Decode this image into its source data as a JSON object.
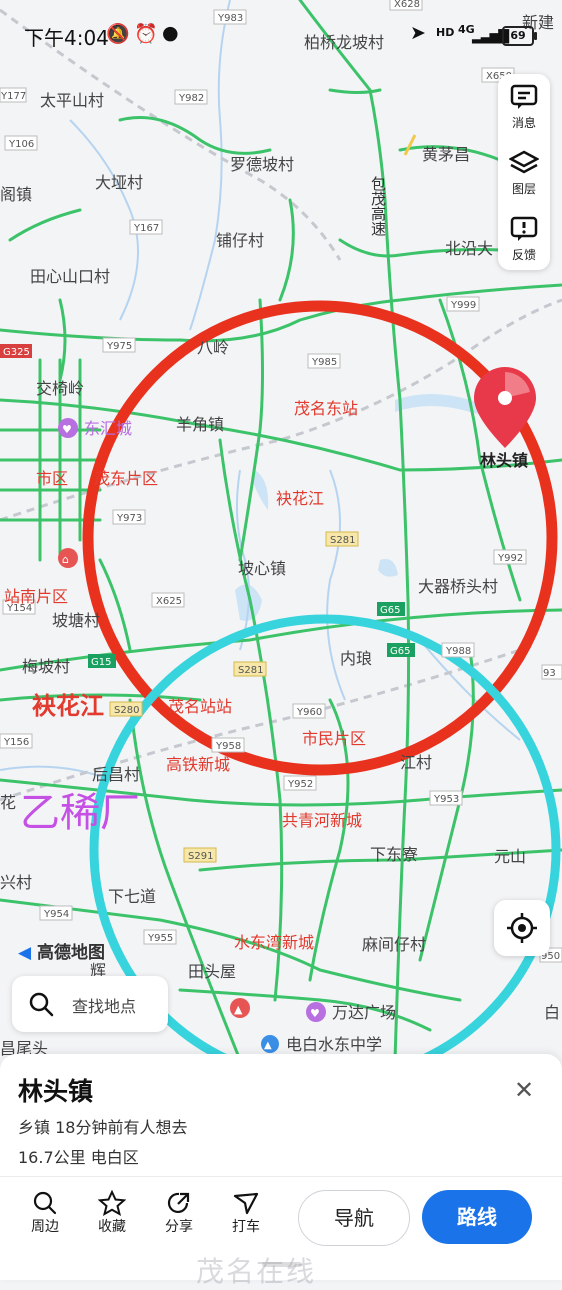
{
  "status_bar": {
    "time": "下午4:04",
    "network": "4G",
    "battery": "69"
  },
  "map": {
    "places": {
      "p1": "柏桥龙坡村",
      "p2": "新建",
      "p3": "太平山村",
      "p4": "罗德坡村",
      "p5": "黄茅昌",
      "p6": "阁镇",
      "p7": "大垭村",
      "p8": "铺仔村",
      "p9": "北沿大",
      "p10": "田心山口村",
      "p11": "八岭",
      "p12": "交椅岭",
      "p13": "东汇城",
      "p14": "羊角镇",
      "p15": "茂名东站",
      "p16": "林头镇",
      "p17": "市区",
      "p18": "茂东片区",
      "p19": "袂花江",
      "p20": "坡心镇",
      "p21": "站南片区",
      "p22": "坡塘村",
      "p23": "大器桥头村",
      "p24": "梅坡村",
      "p25": "内琅",
      "p26": "袂花江",
      "p27": "茂名站站",
      "p28": "市民片区",
      "p29": "高铁新城",
      "p30": "后昌村",
      "p31": "乙稀厂",
      "p32": "共青河新城",
      "p33": "下东寮",
      "p34": "元山",
      "p35": "花",
      "p36": "兴村",
      "p37": "下七道",
      "p38": "水东湾新城",
      "p39": "麻间仔村",
      "p40": "田头屋",
      "p41": "万达广场",
      "p42": "电白水东中学",
      "p43": "辉",
      "p44": "昌尾头",
      "p45": "白",
      "p46": "包茂高速",
      "p47": "江村"
    },
    "road_labels": {
      "r1": "Y983",
      "r2": "X628",
      "r3": "Y177",
      "r4": "Y982",
      "r5": "Y106",
      "r6": "Y167",
      "r7": "X650",
      "r8": "Y999",
      "r9": "Y975",
      "r10": "G325",
      "r11": "Y985",
      "r12": "Y973",
      "r13": "S281",
      "r14": "Y992",
      "r15": "X625",
      "r16": "G65",
      "r17": "Y154",
      "r18": "G65",
      "r19": "G15",
      "r20": "Y988",
      "r21": "S281",
      "r22": "Y960",
      "r23": "S280",
      "r24": "Y958",
      "r25": "Y156",
      "r26": "Y952",
      "r27": "Y953",
      "r28": "S291",
      "r29": "Y954",
      "r30": "Y955",
      "r31": "950",
      "r32": "93"
    },
    "logo": "高德地图",
    "circle_colors": {
      "red": "#e8321e",
      "cyan": "#38d4de"
    },
    "marker_color": "#e8394a"
  },
  "toolbar": {
    "messages": "消息",
    "layers": "图层",
    "feedback": "反馈"
  },
  "search": {
    "placeholder": "查找地点"
  },
  "sheet": {
    "name": "林头镇",
    "meta": "乡镇  18分钟前有人想去",
    "distance": "16.7公里  电白区",
    "actions": {
      "nearby": "周边",
      "favorite": "收藏",
      "share": "分享",
      "taxi": "打车"
    },
    "nav_button": "导航",
    "route_button": "路线"
  },
  "watermark": "茂名在线",
  "colors": {
    "accent": "#1a73e8",
    "road": "#3cc36a",
    "label_red": "#e23a2e",
    "label_purple": "#c450e4"
  }
}
